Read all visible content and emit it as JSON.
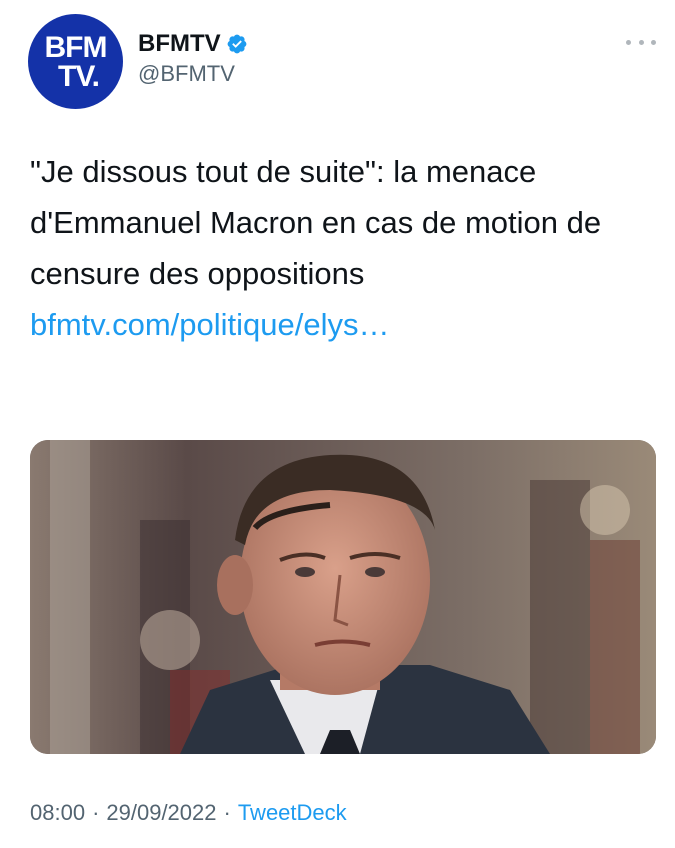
{
  "account": {
    "avatar_line1": "BFM",
    "avatar_line2": "TV.",
    "display_name": "BFMTV",
    "handle": "@BFMTV",
    "verified": true,
    "brand_color": "#1432a8"
  },
  "tweet": {
    "text": "\"Je dissous tout de suite\": la menace d'Emmanuel Macron en cas de motion de censure des oppositions ",
    "link_text": "bfmtv.com/politique/elys…",
    "link_color": "#1d9bf0"
  },
  "meta": {
    "time": "08:00",
    "separator": "·",
    "date": "29/09/2022",
    "source": "TweetDeck"
  },
  "icons": {
    "verified": "verified-badge-icon",
    "more": "more-options-icon"
  }
}
